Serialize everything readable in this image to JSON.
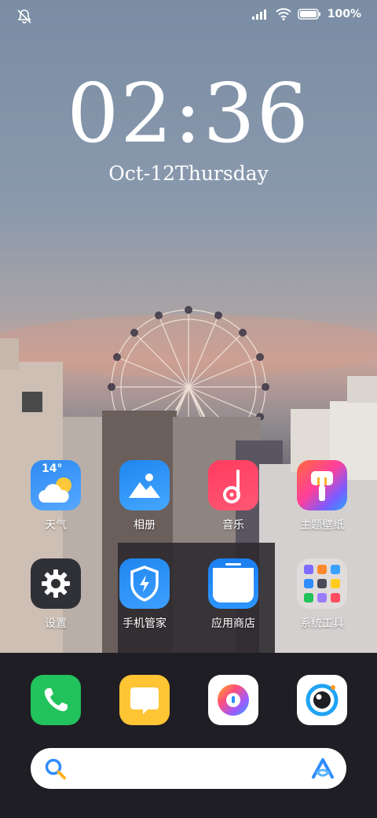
{
  "status_bar": {
    "battery_percent": "100%",
    "icons": [
      "bell-muted-icon",
      "signal-icon",
      "wifi-icon",
      "battery-icon"
    ]
  },
  "clock": {
    "time": "02:36",
    "date": "Oct-12Thursday"
  },
  "apps": [
    {
      "label": "天气",
      "temp": "14°",
      "icon": "weather-icon"
    },
    {
      "label": "相册",
      "icon": "gallery-icon"
    },
    {
      "label": "音乐",
      "icon": "music-icon"
    },
    {
      "label": "主题壁纸",
      "icon": "themes-icon"
    },
    {
      "label": "设置",
      "icon": "settings-icon"
    },
    {
      "label": "手机管家",
      "icon": "security-icon"
    },
    {
      "label": "应用商店",
      "icon": "app-store-icon"
    },
    {
      "label": "系统工具",
      "icon": "system-tools-folder-icon"
    }
  ],
  "dock": [
    {
      "icon": "phone-icon"
    },
    {
      "icon": "messages-icon"
    },
    {
      "icon": "browser-icon"
    },
    {
      "icon": "camera-icon"
    }
  ],
  "search": {
    "icon": "search-icon",
    "assistant_icon": "assistant-icon"
  }
}
